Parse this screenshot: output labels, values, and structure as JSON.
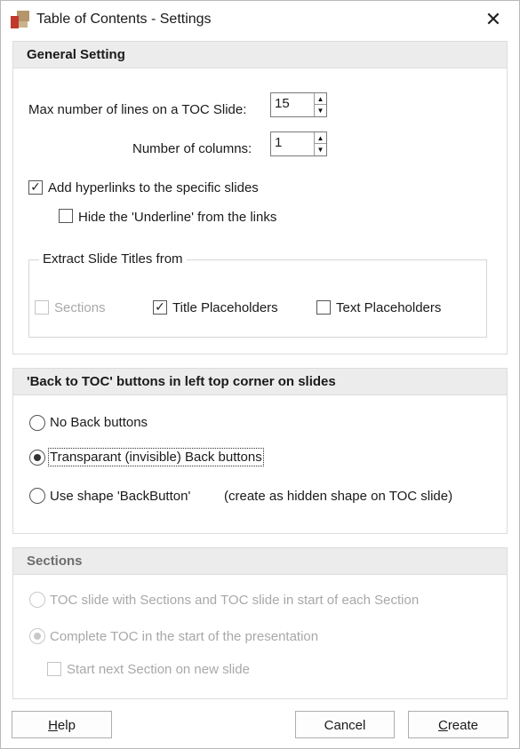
{
  "window": {
    "title": "Table of Contents - Settings"
  },
  "general": {
    "header": "General Setting",
    "max_lines_label": "Max number of lines on a TOC Slide:",
    "max_lines_value": "15",
    "columns_label": "Number of columns:",
    "columns_value": "1",
    "add_hyperlinks_label": "Add hyperlinks to the specific slides",
    "add_hyperlinks_checked": true,
    "hide_underline_label": "Hide the 'Underline' from the links",
    "hide_underline_checked": false,
    "extract": {
      "legend": "Extract Slide Titles from",
      "sections_label": "Sections",
      "sections_checked": false,
      "title_placeholders_label": "Title Placeholders",
      "title_placeholders_checked": true,
      "text_placeholders_label": "Text Placeholders",
      "text_placeholders_checked": false
    }
  },
  "back_to_toc": {
    "header": "'Back to TOC' buttons in left top corner on slides",
    "options": [
      {
        "label": "No Back buttons",
        "selected": false
      },
      {
        "label": "Transparant (invisible) Back buttons",
        "selected": true
      },
      {
        "label": "Use shape 'BackButton'",
        "selected": false
      }
    ],
    "shape_note": "(create as hidden shape on TOC slide)"
  },
  "sections": {
    "header": "Sections",
    "options": [
      {
        "label": "TOC slide with Sections and TOC slide in start of each Section",
        "selected": false
      },
      {
        "label": "Complete TOC in the start of the presentation",
        "selected": true
      }
    ],
    "start_next_label": "Start next Section on new slide",
    "start_next_checked": false
  },
  "buttons": {
    "help_mnemonic": "H",
    "help_rest": "elp",
    "cancel": "Cancel",
    "create_mnemonic": "C",
    "create_rest": "reate"
  },
  "icons": {
    "app": "toc-app-icon",
    "close": "close-icon"
  }
}
